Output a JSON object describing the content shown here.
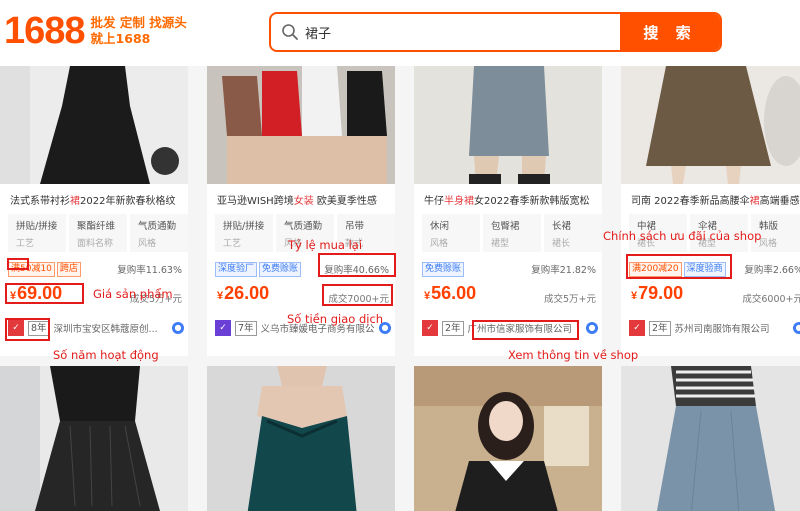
{
  "header": {
    "logo_number": "1688",
    "slogan_line1": "批发 定制 找源头",
    "slogan_line2": "就上1688",
    "search_value": "裙子",
    "search_button": "搜 索"
  },
  "products": [
    {
      "title_pre": "法式系带衬衫",
      "title_hl": "裙",
      "title_post": "2022年新款春秋格纹",
      "attrs": [
        {
          "k": "拼贴/拼接",
          "v": "工艺"
        },
        {
          "k": "聚酯纤维",
          "v": "面料名称"
        },
        {
          "k": "气质通勤",
          "v": "风格"
        }
      ],
      "tags": [
        {
          "text": "满50减10",
          "style": "red"
        },
        {
          "text": "跨店",
          "style": "red"
        }
      ],
      "repurchase": "复购率11.63%",
      "currency": "¥",
      "price": "69.00",
      "volume": "成交5万+元",
      "shop_years": "8年",
      "shop_name": "深圳市宝安区韩蔻原创...",
      "badge_color": "#e4393c"
    },
    {
      "title_pre": "亚马逊WISH跨境",
      "title_hl": "女装",
      "title_post": " 欧美夏季性感",
      "attrs": [
        {
          "k": "拼贴/拼接",
          "v": "工艺"
        },
        {
          "k": "气质通勤",
          "v": "风格"
        },
        {
          "k": "吊带",
          "v": "款式"
        }
      ],
      "tags": [
        {
          "text": "深度验厂",
          "style": "blue"
        },
        {
          "text": "免费赊账",
          "style": "blue"
        }
      ],
      "repurchase": "复购率40.66%",
      "currency": "¥",
      "price": "26.00",
      "volume": "成交7000+元",
      "shop_years": "7年",
      "shop_name": "义乌市臻媛电子商务有限公司",
      "badge_color": "#6a3fd6"
    },
    {
      "title_pre": "牛仔",
      "title_hl": "半身裙",
      "title_post": "女2022春季新款韩版宽松",
      "attrs": [
        {
          "k": "休闲",
          "v": "风格"
        },
        {
          "k": "包臀裙",
          "v": "裙型"
        },
        {
          "k": "长裙",
          "v": "裙长"
        }
      ],
      "tags": [
        {
          "text": "免费赊账",
          "style": "blue"
        }
      ],
      "repurchase": "复购率21.82%",
      "currency": "¥",
      "price": "56.00",
      "volume": "成交5万+元",
      "shop_years": "2年",
      "shop_name": "广州市信家服饰有限公司",
      "badge_color": "#e4393c"
    },
    {
      "title_pre": "司南 2022春季新品高腰伞",
      "title_hl": "裙",
      "title_post": "高端垂感",
      "attrs": [
        {
          "k": "中裙",
          "v": "裙长"
        },
        {
          "k": "伞裙",
          "v": "裙型"
        },
        {
          "k": "韩版",
          "v": "风格"
        }
      ],
      "tags": [
        {
          "text": "满200减20",
          "style": "red"
        },
        {
          "text": "深度验商",
          "style": "blue"
        }
      ],
      "repurchase": "复购率2.66%",
      "currency": "¥",
      "price": "79.00",
      "volume": "成交6000+元",
      "shop_years": "2年",
      "shop_name": "苏州司南服饰有限公司",
      "badge_color": "#e4393c"
    }
  ],
  "annotations": {
    "price": "Giá sản phẩm",
    "repurchase": "Tỷ lệ mua lại",
    "volume": "Số tiền giao dịch",
    "years": "Số năm hoạt động",
    "shop": "Xem thông tin về shop",
    "promo": "Chính sách ưu đãi của shop"
  },
  "colors": {
    "brand": "#ff5000",
    "price": "#ff4000",
    "annotation": "#e41b1b"
  }
}
